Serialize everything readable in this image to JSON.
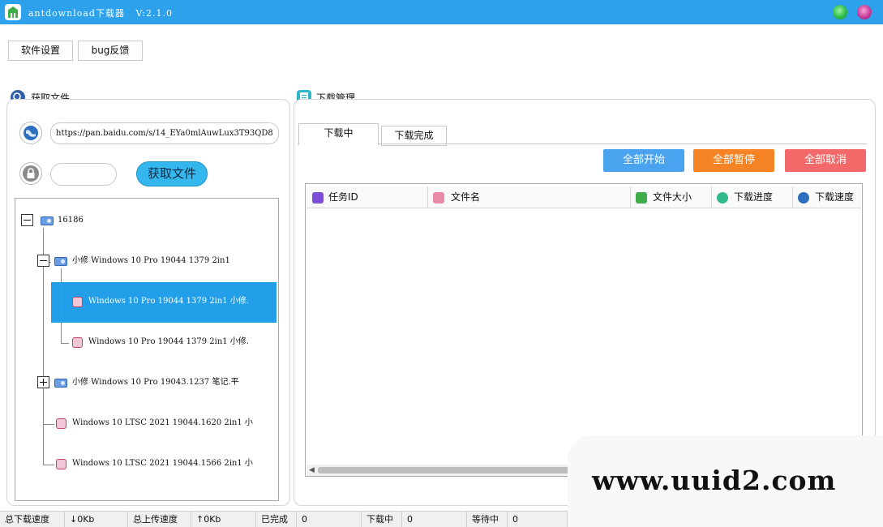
{
  "window": {
    "title": "antdownload下载器",
    "version": "V:2.1.0"
  },
  "toolbar": {
    "settings_label": "软件设置",
    "feedback_label": "bug反馈"
  },
  "fetch_panel": {
    "title": "获取文件",
    "url_value": "https://pan.baidu.com/s/14_EYa0mlAuwLux3T93QD8",
    "password_value": "",
    "fetch_button_label": "获取文件"
  },
  "file_tree": {
    "root": "16186",
    "folder_1": "小修 Windows 10 Pro 19044 1379 2in1",
    "file_1": "Windows 10 Pro 19044 1379 2in1 小修.",
    "file_2": "Windows 10 Pro 19044 1379 2in1 小修.",
    "folder_2": "小修 Windows 10 Pro 19043.1237 笔记.平",
    "file_3": "Windows 10 LTSC 2021 19044.1620 2in1 小",
    "file_4": "Windows 10 LTSC 2021 19044.1566 2in1 小"
  },
  "download_panel": {
    "title": "下载管理",
    "tabs": [
      "下载中",
      "下载完成"
    ],
    "start_all_label": "全部开始",
    "pause_all_label": "全部暂停",
    "cancel_all_label": "全部取消",
    "columns": [
      "任务ID",
      "文件名",
      "文件大小",
      "下载进度",
      "下载速度"
    ]
  },
  "statusbar": {
    "total_down_label": "总下载速度",
    "total_down_value": "↓0Kb",
    "total_up_label": "总上传速度",
    "total_up_value": "↑0Kb",
    "done_label": "已完成",
    "done_value": "0",
    "downloading_label": "下载中",
    "downloading_value": "0",
    "waiting_label": "等待中",
    "waiting_value": "0"
  },
  "watermark": "www.uuid2.com",
  "colors": {
    "titlebar": "#2ea1ec",
    "selection": "#229fe8",
    "start": "#4aa3ee",
    "pause": "#f68424",
    "cancel": "#f36868"
  }
}
